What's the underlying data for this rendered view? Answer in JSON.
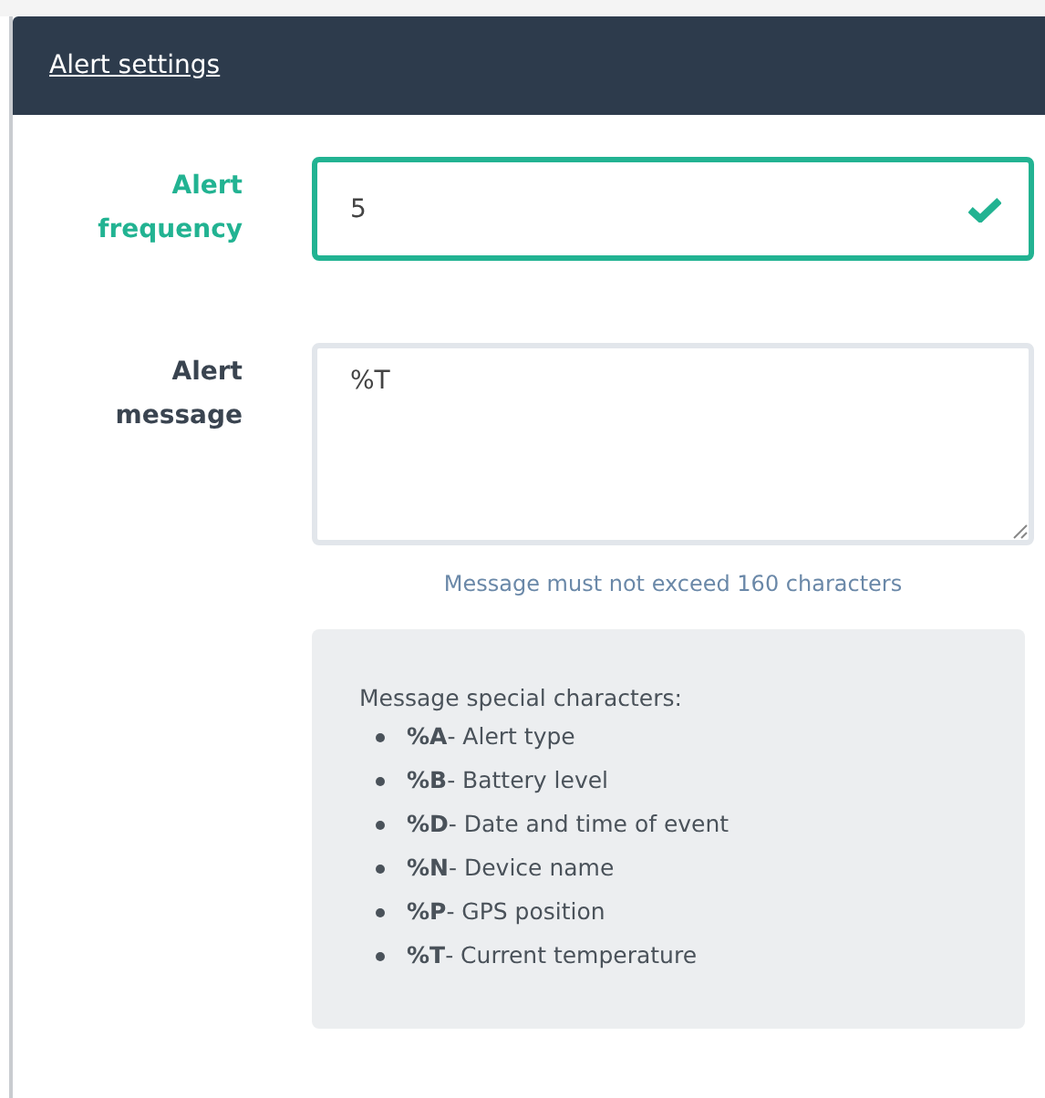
{
  "panel": {
    "title": "Alert settings"
  },
  "fields": [
    {
      "kind": "input",
      "label": "Alert frequency",
      "value": "5",
      "valid": true
    },
    {
      "kind": "textarea",
      "label": "Alert message",
      "value": "%T",
      "valid": false,
      "hint": "Message must not exceed 160 characters"
    }
  ],
  "help": {
    "title": "Message special characters:",
    "items": [
      "**%A**- Alert type",
      "**%B**- Battery level",
      "**%D**- Date and time of event",
      "**%N**- Device name",
      "**%P**- GPS position",
      "**%T**- Current temperature"
    ]
  }
}
